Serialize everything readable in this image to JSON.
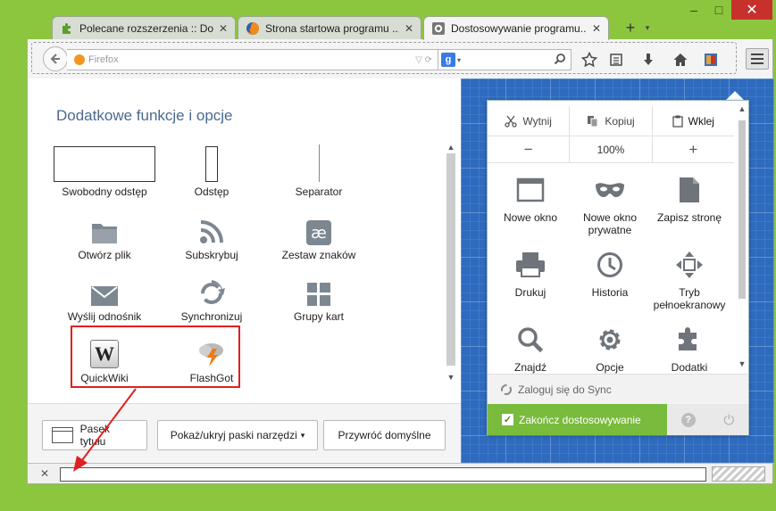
{
  "window": {
    "minimize_glyph": "–",
    "maximize_glyph": "□",
    "close_glyph": "✕"
  },
  "tabs": [
    {
      "label": "Polecane rozszerzenia :: Do...",
      "icon": "puzzle-icon",
      "active": false
    },
    {
      "label": "Strona startowa programu ...",
      "icon": "firefox-icon",
      "active": false
    },
    {
      "label": "Dostosowywanie programu...",
      "icon": "gear-icon",
      "active": true
    }
  ],
  "tab_close_glyph": "✕",
  "new_tab_glyph": "+",
  "urlbar": {
    "placeholder": "Firefox"
  },
  "searchbar": {
    "engine": "g"
  },
  "palette": {
    "title": "Dodatkowe funkcje i opcje",
    "items": [
      {
        "label": "Swobodny odstęp",
        "icon": "flexible-space-icon"
      },
      {
        "label": "Odstęp",
        "icon": "space-icon"
      },
      {
        "label": "Separator",
        "icon": "separator-icon"
      },
      {
        "label": "Otwórz plik",
        "icon": "folder-icon"
      },
      {
        "label": "Subskrybuj",
        "icon": "rss-icon"
      },
      {
        "label": "Zestaw znaków",
        "icon": "charset-icon"
      },
      {
        "label": "Wyślij odnośnik",
        "icon": "mail-icon"
      },
      {
        "label": "Synchronizuj",
        "icon": "sync-icon"
      },
      {
        "label": "Grupy kart",
        "icon": "tab-groups-icon"
      },
      {
        "label": "QuickWiki",
        "icon": "wikipedia-icon"
      },
      {
        "label": "FlashGot",
        "icon": "flashgot-icon"
      }
    ],
    "charset_glyph": "æ",
    "wiki_glyph": "W"
  },
  "bottom_buttons": {
    "title_bar": "Pasek tytułu",
    "toolbars": "Pokaż/ukryj paski narzędzi",
    "toolbars_arrow": "▾",
    "restore": "Przywróć domyślne"
  },
  "menu_panel": {
    "cut": "Wytnij",
    "copy": "Kopiuj",
    "paste": "Wklej",
    "zoom_out": "−",
    "zoom_level": "100%",
    "zoom_in": "+",
    "tools": [
      {
        "label": "Nowe okno",
        "icon": "new-window-icon"
      },
      {
        "label": "Nowe okno prywatne",
        "icon": "private-mask-icon"
      },
      {
        "label": "Zapisz stronę",
        "icon": "save-page-icon"
      },
      {
        "label": "Drukuj",
        "icon": "printer-icon"
      },
      {
        "label": "Historia",
        "icon": "history-clock-icon"
      },
      {
        "label": "Tryb pełnoekranowy",
        "icon": "fullscreen-icon"
      },
      {
        "label": "Znajdź",
        "icon": "find-icon"
      },
      {
        "label": "Opcje",
        "icon": "options-gear-icon"
      },
      {
        "label": "Dodatki",
        "icon": "addons-puzzle-icon"
      }
    ],
    "sync_label": "Zaloguj się do Sync",
    "done_label": "Zakończ dostosowywanie",
    "done_check": "✓",
    "help_glyph": "?",
    "power_glyph": "⏻"
  },
  "addon_bar": {
    "close_glyph": "✕"
  },
  "colors": {
    "frame": "#8cc63f",
    "blueprint": "#2e6bbf",
    "done": "#79bb3c",
    "highlight": "#e02020",
    "title_text": "#4a6a90"
  }
}
